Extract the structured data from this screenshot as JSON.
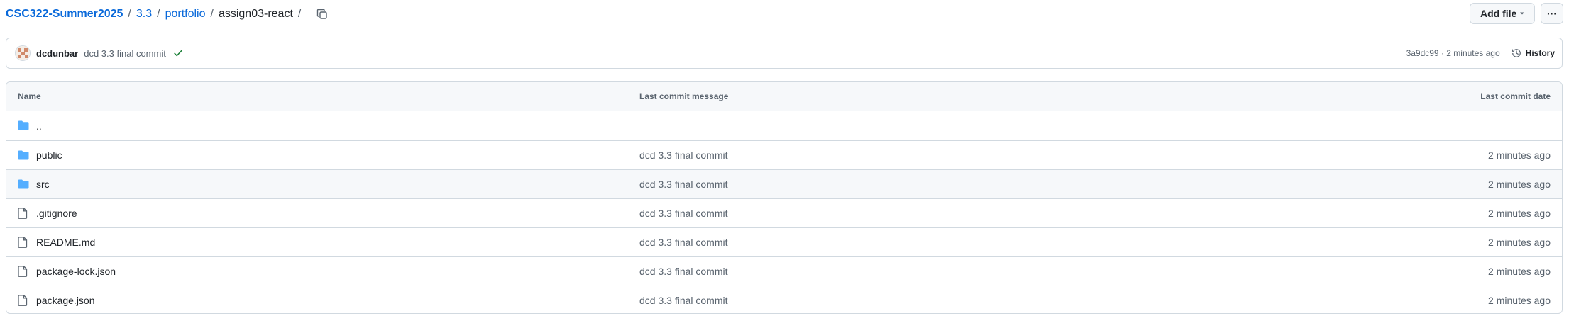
{
  "breadcrumb": {
    "repo": "CSC322-Summer2025",
    "sep": "/",
    "parts": [
      "3.3",
      "portfolio"
    ],
    "current": "assign03-react"
  },
  "actions": {
    "add_file": "Add file",
    "more": "···"
  },
  "commit": {
    "author": "dcdunbar",
    "message": "dcd 3.3 final commit",
    "meta": "3a9dc99 · 2 minutes ago",
    "history": "History",
    "status_color": "#1a7f37"
  },
  "table": {
    "headers": {
      "name": "Name",
      "message": "Last commit message",
      "date": "Last commit date"
    },
    "rows": [
      {
        "name": "..",
        "type": "folder",
        "message": "",
        "date": ""
      },
      {
        "name": "public",
        "type": "folder",
        "message": "dcd 3.3 final commit",
        "date": "2 minutes ago"
      },
      {
        "name": "src",
        "type": "folder",
        "message": "dcd 3.3 final commit",
        "date": "2 minutes ago"
      },
      {
        "name": ".gitignore",
        "type": "file",
        "message": "dcd 3.3 final commit",
        "date": "2 minutes ago"
      },
      {
        "name": "README.md",
        "type": "file",
        "message": "dcd 3.3 final commit",
        "date": "2 minutes ago"
      },
      {
        "name": "package-lock.json",
        "type": "file",
        "message": "dcd 3.3 final commit",
        "date": "2 minutes ago"
      },
      {
        "name": "package.json",
        "type": "file",
        "message": "dcd 3.3 final commit",
        "date": "2 minutes ago"
      }
    ]
  },
  "colors": {
    "link": "#0969da",
    "folder": "#54aeff",
    "border": "#d1d9e0",
    "header_bg": "#f6f8fa"
  },
  "icons": {
    "folder": "folder-icon",
    "file": "file-icon",
    "copy": "copy-icon",
    "history": "history-icon",
    "check": "check-icon"
  }
}
